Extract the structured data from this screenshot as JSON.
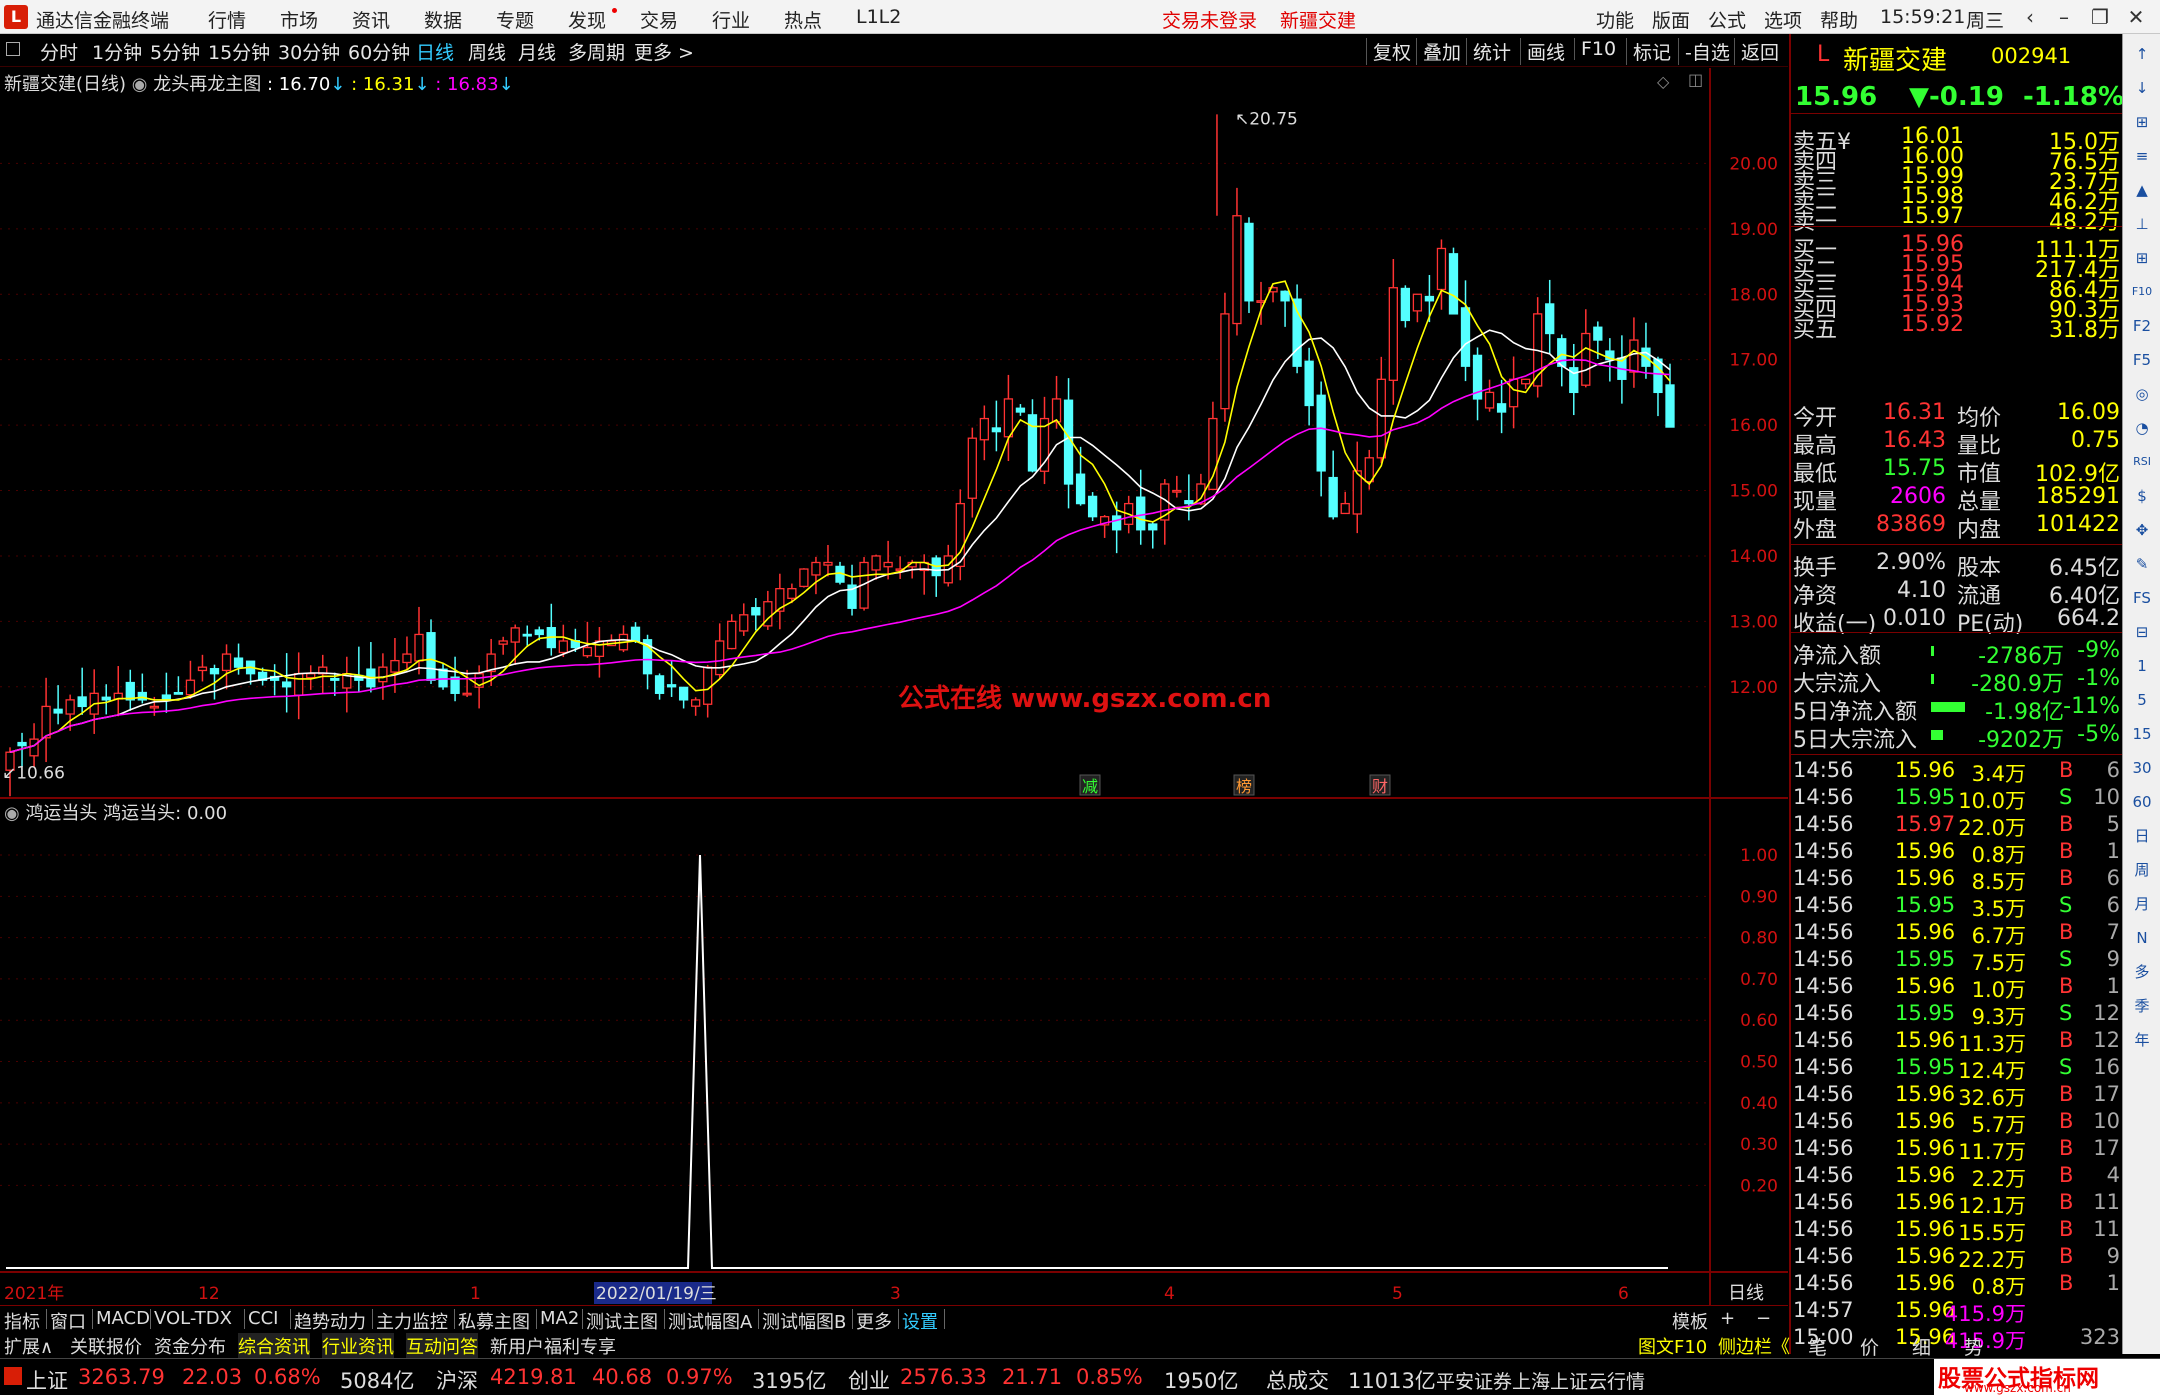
{
  "app": {
    "logo": "L",
    "title": "通达信金融终端",
    "trade_status": "交易未登录",
    "stock_name_top": "新疆交建",
    "clock": "15:59:21",
    "weekday": "周三"
  },
  "menu": [
    "行情",
    "市场",
    "资讯",
    "数据",
    "专题",
    "发现",
    "交易",
    "行业",
    "热点",
    "L1L2"
  ],
  "menu_right": [
    "功能",
    "版面",
    "公式",
    "选项",
    "帮助"
  ],
  "periods": [
    "分时",
    "1分钟",
    "5分钟",
    "15分钟",
    "30分钟",
    "60分钟",
    "日线",
    "周线",
    "月线",
    "多周期",
    "更多 >"
  ],
  "toolbar": [
    "复权",
    "叠加",
    "统计",
    "画线",
    "F10",
    "标记",
    "-自选",
    "返回"
  ],
  "chart_header": {
    "title": "新疆交建(日线)",
    "formula": "龙头再龙主图",
    "v1": ": 16.70",
    "v2": ": 16.31",
    "v3": ": 16.83"
  },
  "watermark": "公式在线  www.gszx.com.cn",
  "markers": [
    "减",
    "榜",
    "财"
  ],
  "price_high_label": "20.75",
  "price_low_label": "10.66",
  "indicator_header": {
    "name": "鸿运当头",
    "label": "鸿运当头: 0.00"
  },
  "x_axis": [
    "2021年",
    "12",
    "1",
    "2022/01/19/三",
    "3",
    "4",
    "5",
    "6"
  ],
  "x_axis_right": "日线",
  "colors": {
    "up": "#ff3232",
    "down": "#54ffff",
    "ma1": "#ffffff",
    "ma2": "#ffff00",
    "ma3": "#ff00ff",
    "axis": "#d11111",
    "grid": "#4a0000"
  },
  "chart_data": [
    {
      "type": "candlestick",
      "title": "新疆交建(日线)",
      "ylim": [
        10.3,
        21.0
      ],
      "y_ticks": [
        12,
        13,
        14,
        15,
        16,
        17,
        18,
        19,
        20
      ],
      "series": [
        {
          "name": "ma",
          "color": "#ffffff"
        },
        {
          "name": "ma",
          "color": "#ffff00"
        },
        {
          "name": "ma",
          "color": "#ff00ff"
        }
      ],
      "ohlc_close": [
        11.0,
        11.1,
        11.2,
        11.7,
        11.6,
        11.8,
        11.7,
        11.9,
        11.8,
        11.9,
        11.8,
        11.8,
        11.7,
        11.8,
        11.9,
        12.1,
        12.3,
        12.2,
        12.5,
        12.3,
        12.2,
        12.1,
        12.1,
        12.0,
        12.2,
        12.2,
        12.3,
        12.1,
        12.2,
        12.1,
        12.0,
        12.3,
        12.4,
        12.5,
        12.8,
        12.1,
        12.0,
        11.9,
        11.9,
        12.2,
        12.5,
        12.7,
        12.9,
        12.8,
        12.8,
        12.6,
        12.7,
        12.6,
        12.6,
        12.7,
        12.7,
        12.8,
        12.7,
        12.2,
        11.9,
        12.0,
        11.8,
        11.8,
        12.3,
        12.7,
        13.0,
        13.1,
        13.1,
        13.3,
        13.5,
        13.5,
        13.8,
        13.9,
        13.9,
        13.6,
        13.2,
        13.9,
        14.0,
        13.9,
        13.8,
        13.9,
        13.9,
        13.7,
        14.0,
        14.8,
        15.8,
        16.1,
        15.9,
        16.4,
        16.2,
        15.3,
        16.1,
        16.4,
        15.1,
        14.8,
        14.6,
        14.6,
        14.4,
        14.8,
        14.4,
        14.4,
        15.1,
        15.0,
        14.8,
        15.1,
        16.1,
        17.7,
        19.2,
        17.9,
        17.9,
        18.1,
        17.9,
        16.9,
        16.3,
        15.3,
        14.6,
        14.8,
        15.3,
        15.5,
        16.7,
        18.1,
        17.6,
        18.0,
        17.9,
        18.7,
        17.7,
        16.9,
        16.4,
        16.5,
        16.2,
        16.7,
        16.7,
        17.7,
        17.4,
        16.9,
        16.5,
        17.4,
        17.3,
        17.0,
        16.7,
        17.3,
        16.9,
        16.5,
        15.97
      ],
      "high": 20.75,
      "low": 10.66
    },
    {
      "type": "line",
      "title": "鸿运当头",
      "ylim": [
        0,
        1.08
      ],
      "y_ticks": [
        0.2,
        0.3,
        0.4,
        0.5,
        0.6,
        0.7,
        0.8,
        0.9,
        1.0
      ],
      "series": [
        {
          "name": "鸿运当头",
          "values": "all 0 except spike 1.00 at 2022/01/19"
        }
      ]
    }
  ],
  "quote": {
    "code": "002941",
    "name": "新疆交建",
    "price": "15.96",
    "change": "▼-0.19",
    "pct": "-1.18%",
    "sell": [
      [
        "卖五¥",
        "16.01",
        "15.0万"
      ],
      [
        "卖四",
        "16.00",
        "76.5万"
      ],
      [
        "卖三",
        "15.99",
        "23.7万"
      ],
      [
        "卖二",
        "15.98",
        "46.2万"
      ],
      [
        "卖一",
        "15.97",
        "48.2万"
      ]
    ],
    "buy": [
      [
        "买一",
        "15.96",
        "111.1万"
      ],
      [
        "买二",
        "15.95",
        "217.4万"
      ],
      [
        "买三",
        "15.94",
        "86.4万"
      ],
      [
        "买四",
        "15.93",
        "90.3万"
      ],
      [
        "买五",
        "15.92",
        "31.8万"
      ]
    ],
    "stats1": [
      [
        "今开",
        "16.31",
        "均价",
        "16.09"
      ],
      [
        "最高",
        "16.43",
        "量比",
        "0.75"
      ],
      [
        "最低",
        "15.75",
        "市值",
        "102.9亿"
      ],
      [
        "现量",
        "2606",
        "总量",
        "185291"
      ],
      [
        "外盘",
        "83869",
        "内盘",
        "101422"
      ]
    ],
    "stats2": [
      [
        "换手",
        "2.90%",
        "股本",
        "6.45亿"
      ],
      [
        "净资",
        "4.10",
        "流通",
        "6.40亿"
      ],
      [
        "收益(一)",
        "0.010",
        "PE(动)",
        "664.2"
      ]
    ],
    "flows": [
      [
        "净流入额",
        "-2786万",
        "-9%"
      ],
      [
        "大宗流入",
        "-280.9万",
        "-1%"
      ],
      [
        "5日净流入额",
        "-1.98亿",
        "-11%"
      ],
      [
        "5日大宗流入",
        "-9202万",
        "-5%"
      ]
    ],
    "ticks": [
      [
        "14:56",
        "15.96",
        "3.4万",
        "B",
        "6"
      ],
      [
        "14:56",
        "15.95",
        "10.0万",
        "S",
        "10"
      ],
      [
        "14:56",
        "15.97",
        "22.0万",
        "B",
        "5"
      ],
      [
        "14:56",
        "15.96",
        "0.8万",
        "B",
        "1"
      ],
      [
        "14:56",
        "15.96",
        "8.5万",
        "B",
        "6"
      ],
      [
        "14:56",
        "15.95",
        "3.5万",
        "S",
        "6"
      ],
      [
        "14:56",
        "15.96",
        "6.7万",
        "B",
        "7"
      ],
      [
        "14:56",
        "15.95",
        "7.5万",
        "S",
        "9"
      ],
      [
        "14:56",
        "15.96",
        "1.0万",
        "B",
        "1"
      ],
      [
        "14:56",
        "15.95",
        "9.3万",
        "S",
        "12"
      ],
      [
        "14:56",
        "15.96",
        "11.3万",
        "B",
        "12"
      ],
      [
        "14:56",
        "15.95",
        "12.4万",
        "S",
        "16"
      ],
      [
        "14:56",
        "15.96",
        "32.6万",
        "B",
        "17"
      ],
      [
        "14:56",
        "15.96",
        "5.7万",
        "B",
        "10"
      ],
      [
        "14:56",
        "15.96",
        "11.7万",
        "B",
        "17"
      ],
      [
        "14:56",
        "15.96",
        "2.2万",
        "B",
        "4"
      ],
      [
        "14:56",
        "15.96",
        "12.1万",
        "B",
        "11"
      ],
      [
        "14:56",
        "15.96",
        "15.5万",
        "B",
        "11"
      ],
      [
        "14:56",
        "15.96",
        "22.2万",
        "B",
        "9"
      ],
      [
        "14:56",
        "15.96",
        "0.8万",
        "B",
        "1"
      ],
      [
        "14:57",
        "15.96",
        "415.9万",
        "",
        ""
      ],
      [
        "15:00",
        "15.96",
        "415.9万",
        "",
        "323"
      ]
    ]
  },
  "tools": [
    "↑",
    "↓",
    "⊞",
    "≡",
    "▲",
    "⊥",
    "⊞",
    "F10",
    "F2",
    "F5",
    "◎",
    "◔",
    "RSI",
    "$",
    "✥",
    "✎",
    "FS",
    "⊟",
    "1",
    "5",
    "15",
    "30",
    "60",
    "日",
    "周",
    "月",
    "N",
    "多",
    "季",
    "年"
  ],
  "bottom_tabs": [
    "指标",
    "窗口",
    "MACD",
    "VOL-TDX",
    "CCI",
    "趋势动力",
    "主力监控",
    "私募主图",
    "MA2",
    "测试主图",
    "测试幅图A",
    "测试幅图B",
    "更多",
    "设置"
  ],
  "bottom_right": [
    "模板",
    "+",
    "−"
  ],
  "ext_tabs": [
    "扩展∧",
    "关联报价",
    "资金分布",
    "综合资讯",
    "行业资讯",
    "互动问答",
    "新用户福利专享"
  ],
  "ext_right": [
    "图文F10",
    "侧边栏《",
    "笔",
    "价",
    "细",
    "势"
  ],
  "status": {
    "sh_label": "上证",
    "sh": "3263.79",
    "sh_ch": "22.03",
    "sh_pct": "0.68%",
    "sh_amt": "5084亿",
    "hs_label": "沪深",
    "hs": "4219.81",
    "hs_ch": "40.68",
    "hs_pct": "0.97%",
    "hs_amt": "3195亿",
    "cy_label": "创业",
    "cy": "2576.33",
    "cy_ch": "21.71",
    "cy_pct": "0.85%",
    "cy_amt": "1950亿",
    "total_label": "总成交",
    "total": "11013亿",
    "broker": "平安证券上海上证云行情",
    "brand": "股票公式指标网",
    "brand_url": "www.gszx.com.cn"
  }
}
